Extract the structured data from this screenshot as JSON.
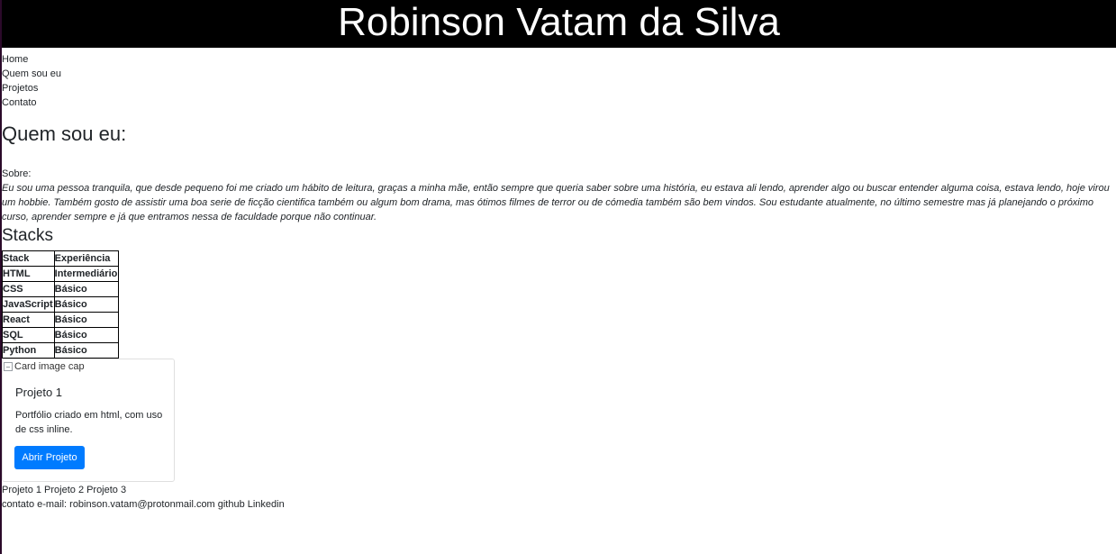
{
  "header": {
    "title": "Robinson Vatam da Silva"
  },
  "nav": {
    "items": [
      {
        "label": "Home"
      },
      {
        "label": "Quem sou eu"
      },
      {
        "label": "Projetos"
      },
      {
        "label": "Contato"
      }
    ]
  },
  "about": {
    "heading": "Quem sou eu:",
    "label": "Sobre:",
    "text": "Eu sou uma pessoa tranquila, que desde pequeno foi me criado um hábito de leitura, graças a minha mãe, então sempre que queria saber sobre uma história, eu estava ali lendo, aprender algo ou buscar entender alguma coisa, estava lendo, hoje virou um hobbie. Também gosto de assistir uma boa serie de ficção cientifica também ou algum bom drama, mas ótimos filmes de terror ou de cómedia também são bem vindos. Sou estudante atualmente, no último semestre mas já planejando o próximo curso, aprender sempre e já que entramos nessa de faculdade porque não continuar."
  },
  "stacks": {
    "heading": "Stacks",
    "headers": [
      "Stack",
      "Experiência"
    ],
    "rows": [
      [
        "HTML",
        "Intermediário"
      ],
      [
        "CSS",
        "Básico"
      ],
      [
        "JavaScript",
        "Básico"
      ],
      [
        "React",
        "Básico"
      ],
      [
        "SQL",
        "Básico"
      ],
      [
        "Python",
        "Básico"
      ]
    ]
  },
  "card": {
    "image_alt": "Card image cap",
    "title": "Projeto 1",
    "text": "Portfólio criado em html, com uso de css inline.",
    "button_label": "Abrir Projeto",
    "button_color": "#007bff"
  },
  "projects": {
    "links": [
      "Projeto 1",
      "Projeto 2",
      "Projeto 3"
    ]
  },
  "contact": {
    "label": "contato",
    "email": "e-mail: robinson.vatam@protonmail.com",
    "github": "github",
    "linkedin": "Linkedin"
  },
  "colors": {
    "header_bg": "#000000",
    "header_text": "#ffffff",
    "accent": "#007bff"
  }
}
